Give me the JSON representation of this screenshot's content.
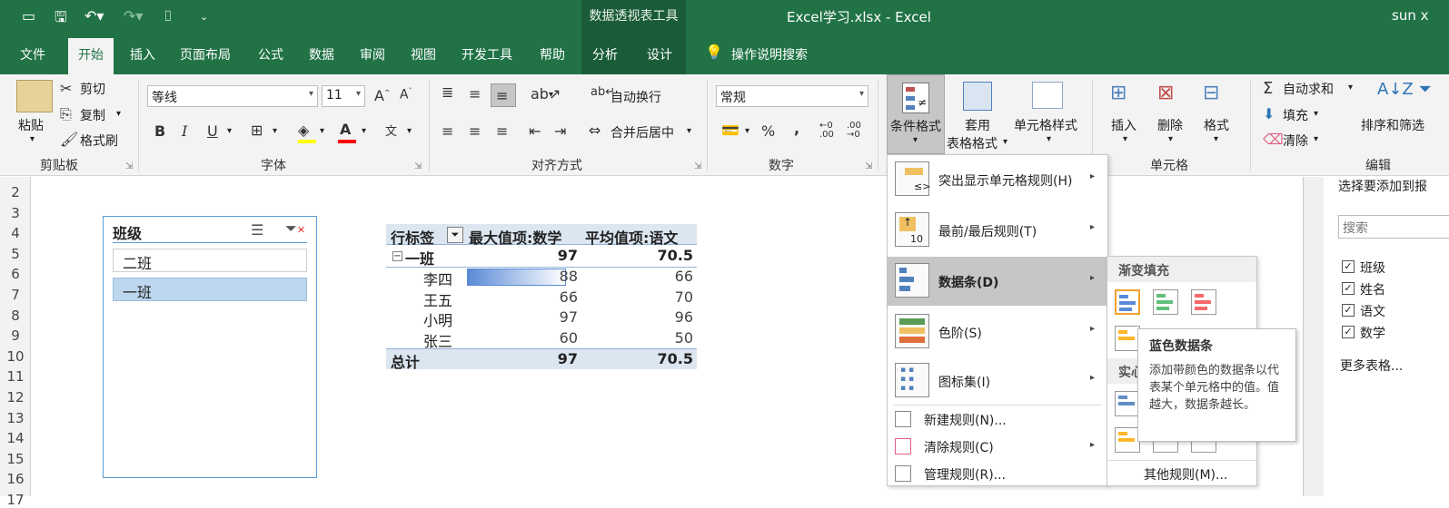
{
  "titlebar": {
    "context_group": "数据透视表工具",
    "title": "Excel学习.xlsx  -  Excel",
    "user": "sun x"
  },
  "tabs": [
    "文件",
    "开始",
    "插入",
    "页面布局",
    "公式",
    "数据",
    "审阅",
    "视图",
    "开发工具",
    "帮助",
    "分析",
    "设计"
  ],
  "tell_me": "操作说明搜索",
  "ribbon": {
    "clipboard": {
      "paste": "粘贴",
      "cut": "剪切",
      "copy": "复制",
      "format_painter": "格式刷",
      "label": "剪贴板"
    },
    "font": {
      "name": "等线",
      "size": "11",
      "bold": "B",
      "italic": "I",
      "underline": "U",
      "label": "字体"
    },
    "alignment": {
      "wrap": "自动换行",
      "merge": "合并后居中",
      "label": "对齐方式"
    },
    "number": {
      "format": "常规",
      "percent": "%",
      "comma": ",",
      "label": "数字"
    },
    "styles": {
      "conditional": "条件格式",
      "table_l1": "套用",
      "table_l2": "表格格式",
      "cell_styles": "单元格样式"
    },
    "cells": {
      "insert": "插入",
      "delete": "删除",
      "format": "格式",
      "label": "单元格"
    },
    "editing": {
      "autosum": "自动求和",
      "fill": "填充",
      "clear": "清除",
      "sort": "排序和筛选",
      "label": "编辑"
    }
  },
  "rows": [
    "2",
    "3",
    "4",
    "5",
    "6",
    "7",
    "8",
    "9",
    "10",
    "11",
    "12",
    "13",
    "14",
    "15",
    "16",
    "17"
  ],
  "slicer": {
    "title": "班级",
    "items": [
      "二班",
      "一班"
    ]
  },
  "pivot": {
    "headers": [
      "行标签",
      "最大值项:数学",
      "平均值项:语文"
    ],
    "group": {
      "label": "一班",
      "max": "97",
      "avg": "70.5"
    },
    "rows": [
      {
        "name": "李四",
        "math": "88",
        "chinese": "66",
        "databar": 0.88
      },
      {
        "name": "王五",
        "math": "66",
        "chinese": "70"
      },
      {
        "name": "小明",
        "math": "97",
        "chinese": "96"
      },
      {
        "name": "张三",
        "math": "60",
        "chinese": "50"
      }
    ],
    "total": {
      "label": "总计",
      "max": "97",
      "avg": "70.5"
    }
  },
  "cf_menu": {
    "items": [
      "突出显示单元格规则(H)",
      "最前/最后规则(T)",
      "数据条(D)",
      "色阶(S)",
      "图标集(I)"
    ],
    "small_items": [
      "新建规则(N)...",
      "清除规则(C)",
      "管理规则(R)..."
    ]
  },
  "submenu": {
    "gradient_header": "渐变填充",
    "solid_header": "实心",
    "more": "其他规则(M)..."
  },
  "tooltip": {
    "title": "蓝色数据条",
    "body": "添加带颜色的数据条以代表某个单元格中的值。值越大，数据条越长。"
  },
  "pane": {
    "header": "选择要添加到报",
    "search_placeholder": "搜索",
    "fields": [
      "班级",
      "姓名",
      "语文",
      "数学"
    ],
    "more": "更多表格..."
  },
  "colors": {
    "excel_green": "#217346",
    "databar_blue": "#5a8ad6",
    "menu_highlight": "#c6c6c6"
  }
}
